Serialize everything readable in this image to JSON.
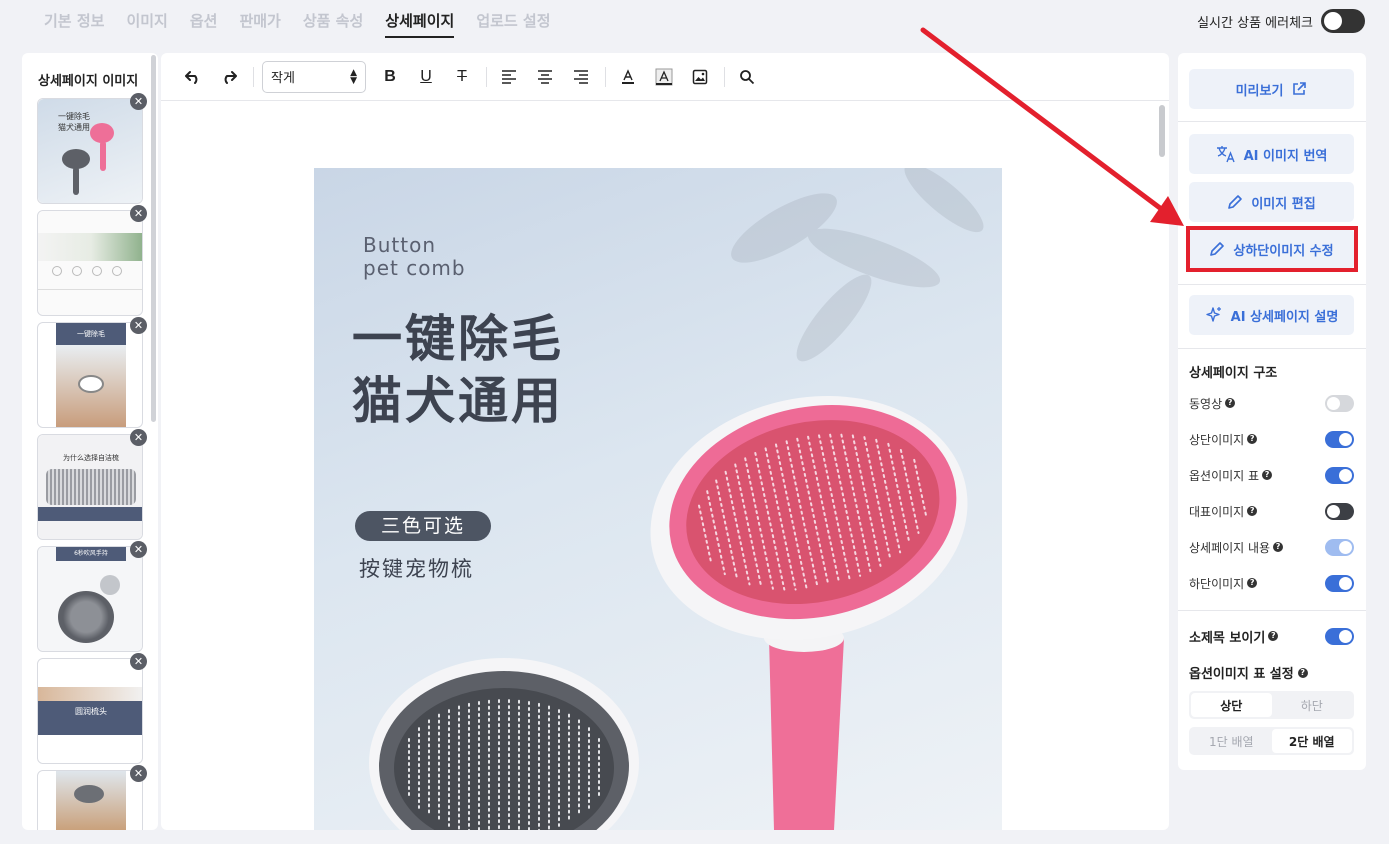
{
  "tabs": [
    "기본 정보",
    "이미지",
    "옵션",
    "판매가",
    "상품 속성",
    "상세페이지",
    "업로드 설정"
  ],
  "active_tab_index": 5,
  "error_check": {
    "label": "실시간 상품 에러체크",
    "enabled": false
  },
  "left_panel": {
    "title": "상세페이지 이미지",
    "remove_icon": "close-icon",
    "thumb_texts": [
      "一键除毛\n猫犬通用",
      "",
      "一键除毛",
      "为什么选择自洁梳",
      "6秒吹风手持",
      "圆润梳头"
    ]
  },
  "toolbar": {
    "font_size": "작게",
    "icons": [
      "undo-icon",
      "redo-icon",
      "bold-icon",
      "underline-icon",
      "strikethrough-icon",
      "align-left-icon",
      "align-center-icon",
      "align-right-icon",
      "font-color-icon",
      "background-color-icon",
      "image-icon",
      "search-icon"
    ],
    "bold": "B",
    "underline": "U",
    "strike": "T"
  },
  "product_image": {
    "eng_line1": "Button",
    "eng_line2": "pet comb",
    "cn_line1": "一键除毛",
    "cn_line2": "猫犬通用",
    "badge": "三色可选",
    "cn_sub": "按键宠物梳",
    "colors": {
      "pink": "#ee6f98",
      "gray": "#5d6067"
    }
  },
  "right_panel": {
    "preview": "미리보기",
    "ai_translate": "AI 이미지 번역",
    "image_edit": "이미지 편집",
    "top_bottom_edit": "상하단이미지 수정",
    "ai_description": "AI 상세페이지 설명",
    "structure_title": "상세페이지 구조",
    "toggles": [
      {
        "label": "동영상",
        "state": "off"
      },
      {
        "label": "상단이미지",
        "state": "on"
      },
      {
        "label": "옵션이미지 표",
        "state": "on"
      },
      {
        "label": "대표이미지",
        "state": "dark"
      },
      {
        "label": "상세페이지 내용",
        "state": "light"
      },
      {
        "label": "하단이미지",
        "state": "on"
      }
    ],
    "subtitle_toggle": {
      "label": "소제목 보이기",
      "state": "on"
    },
    "option_table_title": "옵션이미지 표 설정",
    "position_options": [
      "상단",
      "하단"
    ],
    "position_selected": "상단",
    "layout_options": [
      "1단 배열",
      "2단 배열"
    ],
    "layout_selected": "2단 배열",
    "accent_color": "#3a6fd8",
    "highlight_color": "#e3202d"
  }
}
